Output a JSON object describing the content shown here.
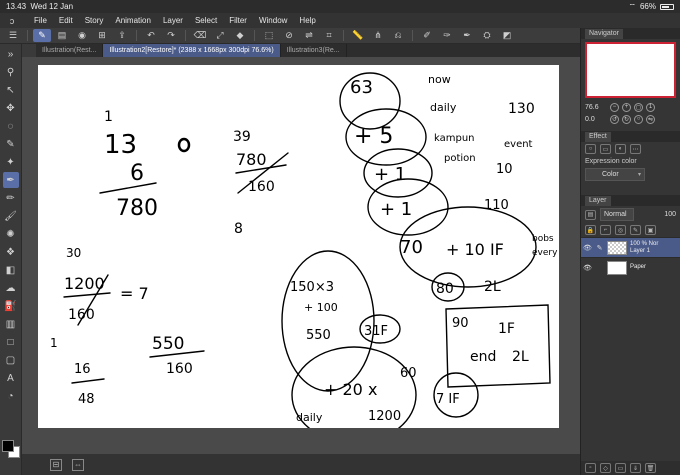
{
  "status": {
    "time": "13.43",
    "date": "Wed 12 Jan",
    "battery": "66%"
  },
  "menu": [
    "File",
    "Edit",
    "Story",
    "Animation",
    "Layer",
    "Select",
    "Filter",
    "Window",
    "Help"
  ],
  "tabs": [
    {
      "label": "Illustration(Rest..."
    },
    {
      "label": "Illustration2[Restore]* (2388 x 1668px 300dpi 76.6%)"
    },
    {
      "label": "Illustration3(Re..."
    }
  ],
  "navigator": {
    "title": "Navigator",
    "zoom": "76.6",
    "angle": "0.0"
  },
  "effect": {
    "title": "Effect",
    "expression_label": "Expression color",
    "expression_value": "Color"
  },
  "layer_panel": {
    "title": "Layer",
    "blend_mode": "Normal",
    "opacity": "100",
    "layers": [
      {
        "name_line1": "100 % Nor",
        "name_line2": "Layer 1"
      },
      {
        "name_line1": "",
        "name_line2": "Paper"
      }
    ]
  },
  "side_tab": {
    "label": "Layer P"
  },
  "canvas_text": {
    "t1": "1",
    "t2": "13",
    "t3": "6",
    "t4": "780",
    "t5": "39",
    "t6": "780",
    "t7": "160",
    "t8": "8",
    "t9": "30",
    "t10": "1200",
    "t11": "160",
    "t12": "= 7",
    "t13": "550",
    "t14": "160",
    "t15": "1",
    "t16": "16",
    "t17": "48",
    "t18": "63",
    "t19": "+ 5",
    "t20": "+ 1",
    "t21": "+ 1",
    "t22": "70",
    "t23": "+ 10 IF",
    "t24": "150×3",
    "t25": "+ 100",
    "t26": "550",
    "t27": "+ 20 x",
    "t28": "1200",
    "t29": "60",
    "t30": "31F",
    "t31": "80",
    "t32": "2L",
    "t33": "90",
    "t34": "1F",
    "t35": "end",
    "t36": "2L",
    "t37": "7 IF",
    "t38": "daily",
    "t39": "130",
    "t40": "10",
    "t41": "110",
    "t42": "daily",
    "t43": "now",
    "t44": "kampun",
    "t45": "potion",
    "t46": "event",
    "t47": "bobs",
    "t48": "every"
  }
}
